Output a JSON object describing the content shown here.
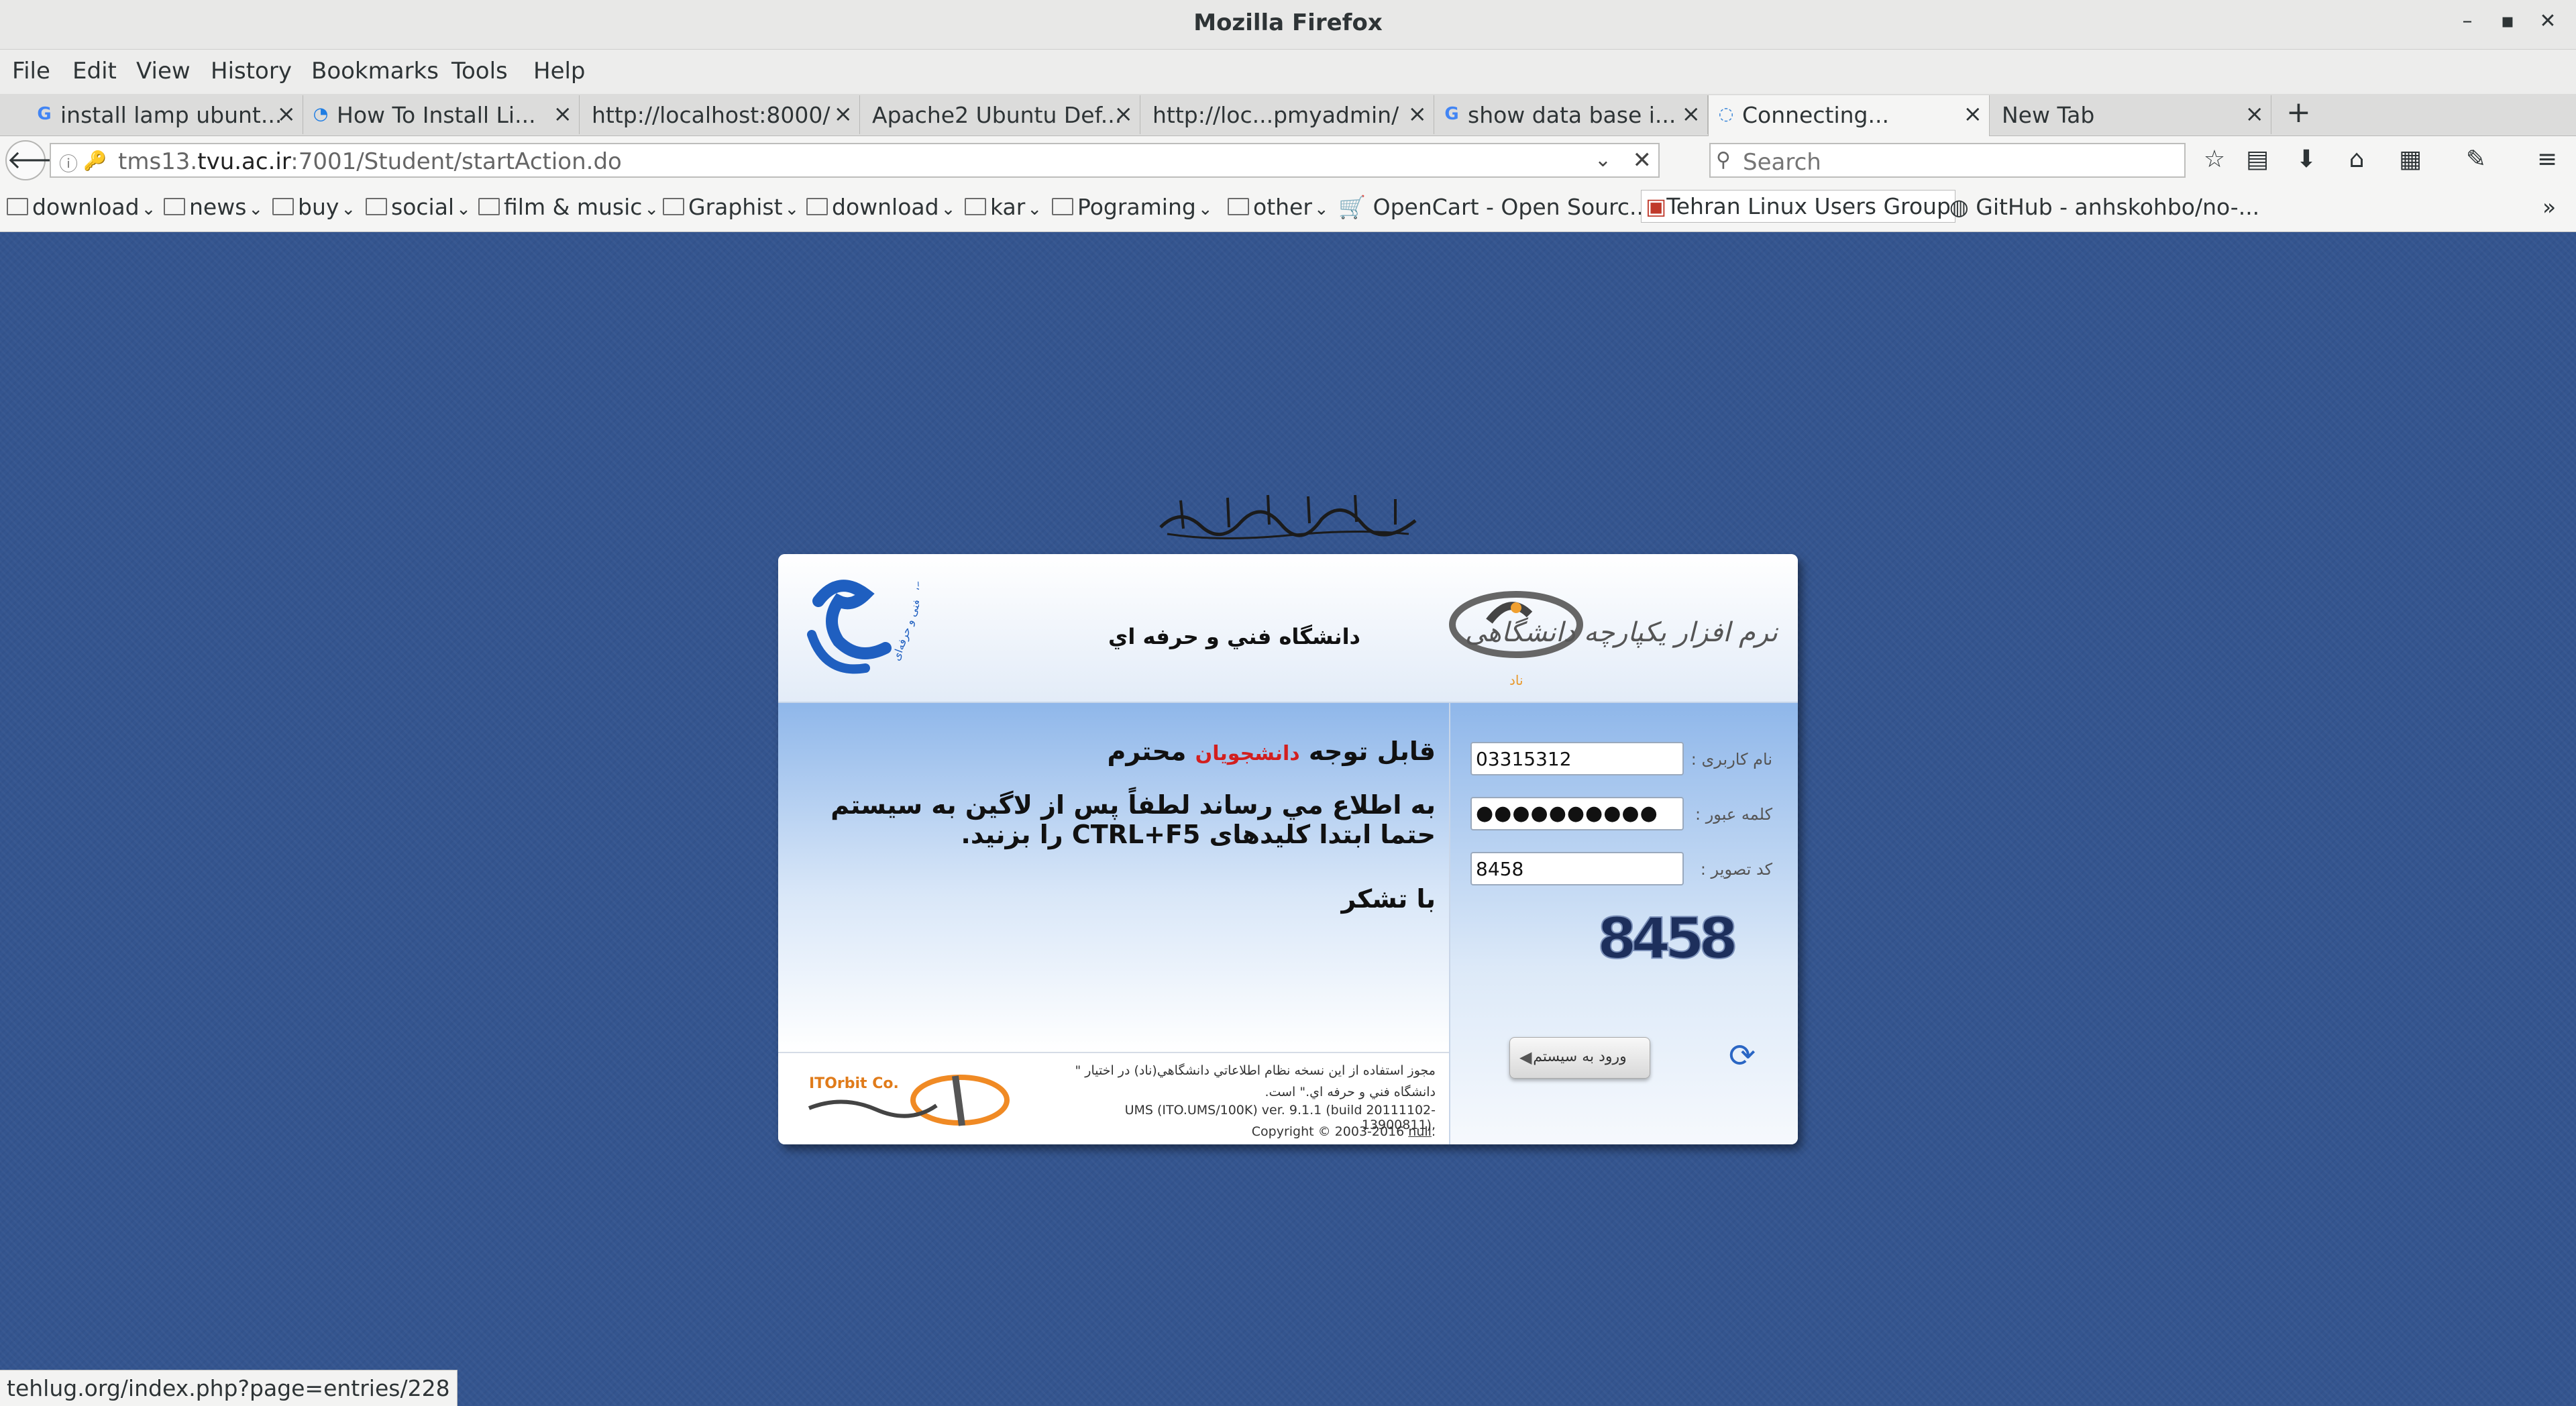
{
  "window": {
    "title": "Mozilla Firefox",
    "controls": [
      "–",
      "▪",
      "✕"
    ]
  },
  "menu": [
    "File",
    "Edit",
    "View",
    "History",
    "Bookmarks",
    "Tools",
    "Help"
  ],
  "tabs": [
    {
      "label": "install lamp ubunt...",
      "icon": "google-icon"
    },
    {
      "label": "How To Install Li...",
      "icon": "digitalocean-icon"
    },
    {
      "label": "http://localhost:8000/",
      "icon": ""
    },
    {
      "label": "Apache2 Ubuntu Def...",
      "icon": ""
    },
    {
      "label": "http://loc...pmyadmin/",
      "icon": ""
    },
    {
      "label": "show data base i...",
      "icon": "google-icon"
    },
    {
      "label": "Connecting...",
      "icon": "loading-icon",
      "active": true
    },
    {
      "label": "New Tab",
      "icon": ""
    }
  ],
  "tab_close": "×",
  "new_tab": "+",
  "url": {
    "prefix": "tms13.",
    "domain": "tvu.ac.ir",
    "rest": ":7001/Student/startAction.do"
  },
  "search": {
    "placeholder": "Search"
  },
  "bookmarks": [
    {
      "label": "download",
      "type": "folder"
    },
    {
      "label": "news",
      "type": "folder"
    },
    {
      "label": "buy",
      "type": "folder"
    },
    {
      "label": "social",
      "type": "folder"
    },
    {
      "label": "film & music",
      "type": "folder"
    },
    {
      "label": "Graphist",
      "type": "folder"
    },
    {
      "label": "download",
      "type": "folder"
    },
    {
      "label": "kar",
      "type": "folder"
    },
    {
      "label": "Pograming",
      "type": "folder"
    },
    {
      "label": "other",
      "type": "folder"
    },
    {
      "label": "OpenCart - Open Sourc...",
      "type": "link"
    },
    {
      "label": "Tehran Linux Users Group",
      "type": "link"
    },
    {
      "label": "GitHub - anhskohbo/no-...",
      "type": "link"
    }
  ],
  "bookmarks_overflow": "»",
  "page": {
    "university_title": "دانشگاه فني و حرفه اي",
    "notice": {
      "line1_part1": "قابل توجه",
      "line1_red": "دانشجویان",
      "line1_part2": "محترم",
      "line2": "به اطلاع مي رساند لطفاً پس از لاگين به سيستم حتما ابتدا کليدهای CTRL+F5 را بزنيد.",
      "line3": "با تشکر"
    },
    "form": {
      "username_label": "نام کاربری :",
      "username_value": "03315312",
      "password_label": "کلمه عبور :",
      "password_value": "●●●●●●●●●●",
      "captcha_label": "کد تصویر :",
      "captcha_value": "8458",
      "captcha_image_text": "8458",
      "login_button": "ورود به سیستم"
    },
    "footer": {
      "license_line": "مجوز استفاده از این نسخه نظام اطلاعاتي دانشگاهي(ناد) در اختيار \" دانشگاه فني و حرفه اي.\" است.",
      "version": "UMS (ITO.UMS/100K) ver. 9.1.1 (build 20111102-13900811),",
      "copyright_prefix": "Copyright © 2003-2016",
      "copyright_link": "null",
      "copyright_suffix": "."
    },
    "logos": {
      "left_caption": "دانشگاه فنی و حرفه‌ای",
      "right_caption": "نرم افزار یکپارچه دانشگاهی",
      "right_sub": "ناد",
      "ito": "ITOrbit Co."
    }
  },
  "status_url": "tehlug.org/index.php?page=entries/228"
}
